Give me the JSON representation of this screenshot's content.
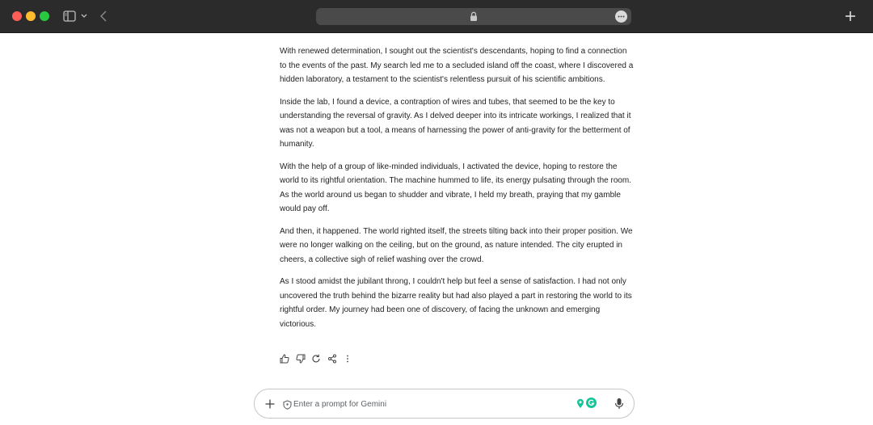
{
  "browser": {
    "address_icon": "lock-icon",
    "icons": [
      "sidebar-toggle-icon",
      "chevron-down-icon",
      "back-arrow-icon",
      "more-icon",
      "plus-icon"
    ]
  },
  "response": {
    "paragraphs": [
      "With renewed determination, I sought out the scientist's descendants, hoping to find a connection to the events of the past. My search led me to a secluded island off the coast, where I discovered a hidden laboratory, a testament to the scientist's relentless pursuit of his scientific ambitions.",
      "Inside the lab, I found a device, a contraption of wires and tubes, that seemed to be the key to understanding the reversal of gravity. As I delved deeper into its intricate workings, I realized that it was not a weapon but a tool, a means of harnessing the power of anti-gravity for the betterment of humanity.",
      "With the help of a group of like-minded individuals, I activated the device, hoping to restore the world to its rightful orientation. The machine hummed to life, its energy pulsating through the room. As the world around us began to shudder and vibrate, I held my breath, praying that my gamble would pay off.",
      "And then, it happened. The world righted itself, the streets tilting back into their proper position. We were no longer walking on the ceiling, but on the ground, as nature intended. The city erupted in cheers, a collective sigh of relief washing over the crowd.",
      "As I stood amidst the jubilant throng, I couldn't help but feel a sense of satisfaction. I had not only uncovered the truth behind the bizarre reality but had also played a part in restoring the world to its rightful order. My journey had been one of discovery, of facing the unknown and emerging victorious."
    ],
    "actions": [
      "thumbs-up-icon",
      "thumbs-down-icon",
      "regenerate-icon",
      "share-icon",
      "more-vertical-icon"
    ]
  },
  "prompt": {
    "placeholder": "Enter a prompt for Gemini",
    "value": ""
  },
  "colors": {
    "titlebar": "#2b2b2b",
    "address_bar": "#4a4a4a",
    "text": "#1f1f1f",
    "grammarly": "#15c39a",
    "close": "#ff5f57",
    "minimize": "#febc2e",
    "zoom": "#28c840"
  }
}
